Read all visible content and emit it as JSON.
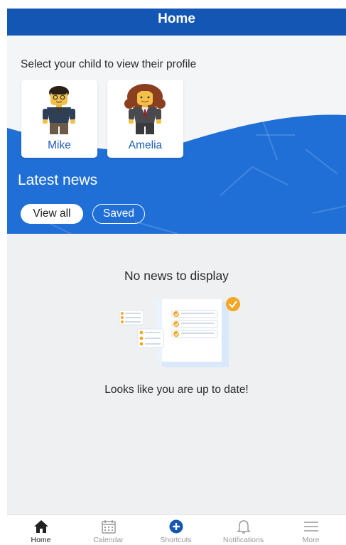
{
  "header": {
    "title": "Home"
  },
  "hero": {
    "prompt": "Select your child to view their profile",
    "children": [
      {
        "name": "Mike",
        "avatar_icon": "lego-figure-boy-icon"
      },
      {
        "name": "Amelia",
        "avatar_icon": "lego-figure-girl-icon"
      }
    ],
    "section_title": "Latest news",
    "buttons": {
      "view_all": "View all",
      "saved": "Saved"
    }
  },
  "news": {
    "empty_title": "No news to display",
    "empty_subtitle": "Looks like you are up to date!",
    "illustration_icon": "checklist-illustration-icon"
  },
  "tabbar": {
    "tabs": [
      {
        "label": "Home",
        "icon": "home-icon",
        "active": true
      },
      {
        "label": "Calendar",
        "icon": "calendar-icon",
        "active": false
      },
      {
        "label": "Shortcuts",
        "icon": "plus-circle-icon",
        "active": false
      },
      {
        "label": "Notifications",
        "icon": "bell-icon",
        "active": false
      },
      {
        "label": "More",
        "icon": "menu-icon",
        "active": false
      }
    ]
  },
  "colors": {
    "primary": "#1356b3",
    "hero_blue": "#1f6fd6",
    "accent": "#f5a623"
  }
}
